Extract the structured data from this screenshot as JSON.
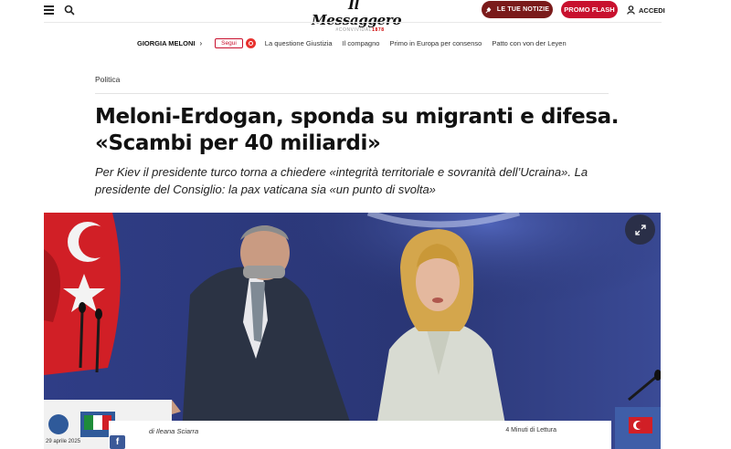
{
  "header": {
    "logo_name": "Il Messaggero",
    "logo_tag_prefix": "#CONVIVIDAL",
    "logo_tag_year": "1878",
    "news_button": "LE TUE NOTIZIE",
    "promo_button": "PROMO FLASH",
    "login_label": "ACCEDI"
  },
  "topics": {
    "main": "GIORGIA MELONI",
    "follow": "Segui",
    "links": [
      "La questione Giustizia",
      "Il compagno",
      "Primo in Europa per consenso",
      "Patto con von der Leyen"
    ]
  },
  "article": {
    "section": "Politica",
    "headline": "Meloni-Erdogan, sponda su migranti e difesa. «Scambi per 40 miliardi»",
    "subhead": "Per Kiev il presidente turco torna a chiedere «integrità territoriale e sovranità dell’Ucraina». La presidente del Consiglio: la pax vaticana sia «un punto di svolta»",
    "byline": "di Ileana Sciarra",
    "read_time": "4 Minuti di Lettura",
    "photo_date": "29 aprile 2025"
  },
  "colors": {
    "news_button_bg": "#7a1a1a",
    "promo_button_bg": "#c8102e",
    "accent_red": "#c8102e",
    "facebook_blue": "#3b5998"
  },
  "icons": {
    "menu": "hamburger-icon",
    "search": "search-icon",
    "news": "bell-icon",
    "login": "user-icon",
    "expand": "expand-icon",
    "facebook": "facebook-icon"
  }
}
